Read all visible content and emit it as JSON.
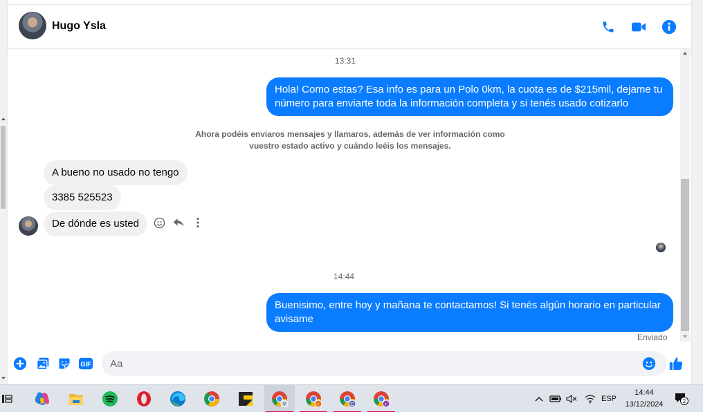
{
  "header": {
    "contact_name": "Hugo Ysla",
    "icons": [
      "phone-icon",
      "video-camera-icon",
      "info-icon"
    ]
  },
  "messages": {
    "timestamp_1": "13:31",
    "outgoing_1": "Hola! Como estas? Esa info es para un Polo 0km, la cuota es de $215mil, dejame tu número para enviarte toda la información completa y si tenés usado cotizarlo",
    "notice": "Ahora podéis enviaros mensajes y llamaros, además de ver información como vuestro estado activo y cuándo leéis los mensajes.",
    "incoming_1": "A bueno no usado no tengo",
    "incoming_2": "3385 525523",
    "incoming_3": "De dónde es usted",
    "timestamp_2": "14:44",
    "outgoing_2": "Buenisimo, entre hoy y mañana te contactamos! Si tenés algún horario en particular avisame",
    "status": "Enviado"
  },
  "composer": {
    "placeholder": "Aa",
    "gif_label": "GIF"
  },
  "colors": {
    "accent": "#0a7cff",
    "incoming_bubble": "#f0f0f0"
  },
  "taskbar": {
    "language": "ESP",
    "time": "14:44",
    "date": "13/12/2024",
    "notification_count": "2",
    "chrome_profiles": [
      "Y",
      "r",
      "C",
      "r"
    ]
  }
}
